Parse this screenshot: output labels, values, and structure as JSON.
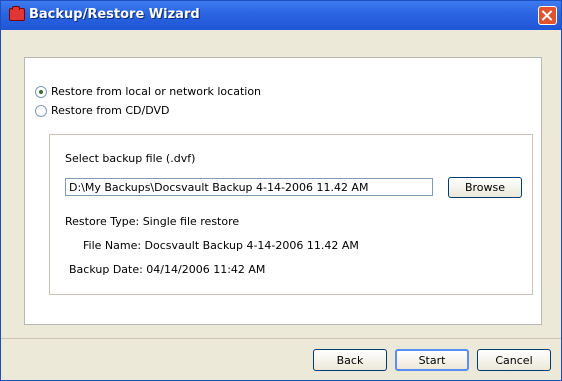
{
  "window": {
    "title": "Backup/Restore Wizard"
  },
  "options": [
    {
      "label": "Restore from local or network location",
      "selected": true
    },
    {
      "label": "Restore from CD/DVD",
      "selected": false
    }
  ],
  "file_section": {
    "label": "Select backup file (.dvf)",
    "value": "D:\\My Backups\\Docsvault Backup 4-14-2006 11.42 AM",
    "browse_label": "Browse"
  },
  "details": {
    "restore_type": "Restore Type: Single file restore",
    "file_name": "File Name: Docsvault Backup 4-14-2006 11.42 AM",
    "backup_date": "Backup Date: 04/14/2006 11:42 AM"
  },
  "footer": {
    "back_label": "Back",
    "start_label": "Start",
    "cancel_label": "Cancel"
  }
}
